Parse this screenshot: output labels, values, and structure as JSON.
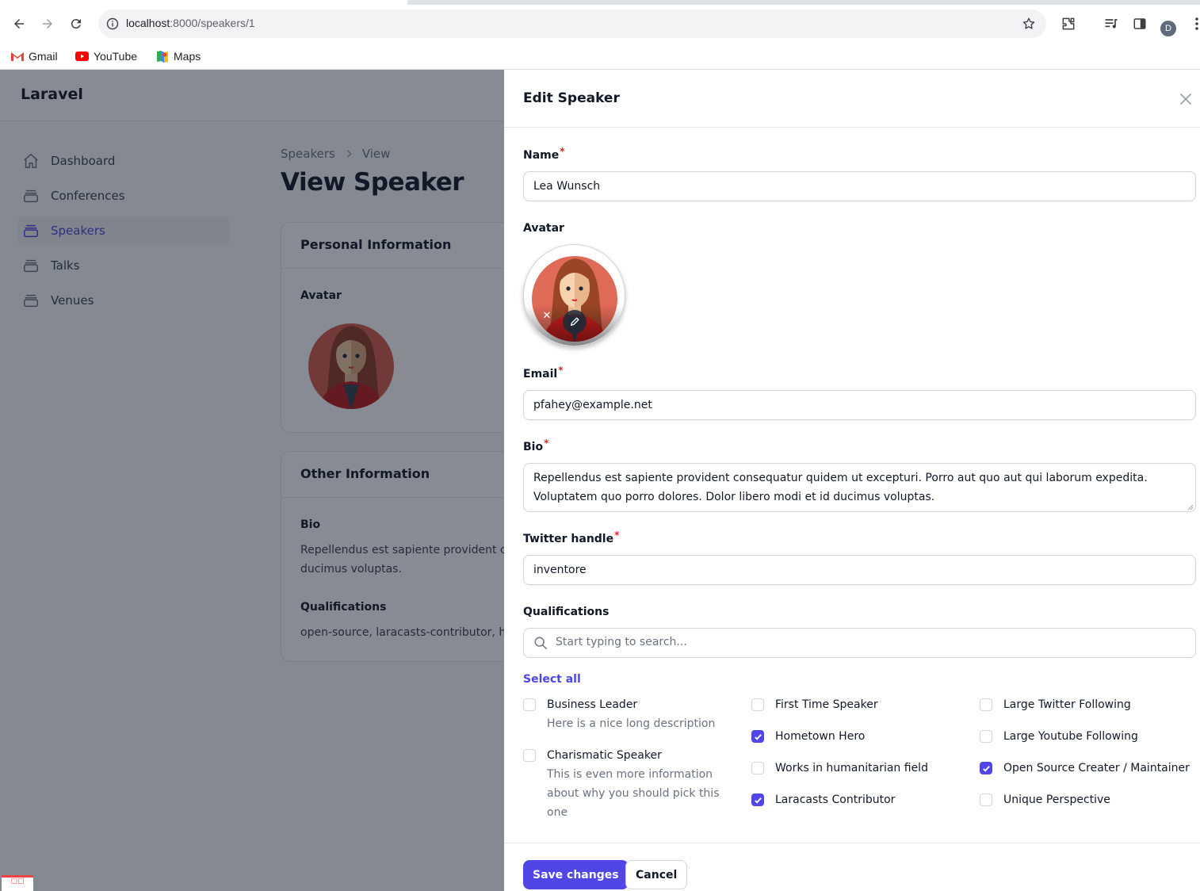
{
  "browser": {
    "url_host": "localhost",
    "url_path": ":8000/speakers/1",
    "profile_initial": "D",
    "bookmarks": [
      {
        "label": "Gmail",
        "icon": "gmail-icon"
      },
      {
        "label": "YouTube",
        "icon": "youtube-icon"
      },
      {
        "label": "Maps",
        "icon": "maps-icon"
      }
    ]
  },
  "app": {
    "brand": "Laravel",
    "nav": [
      {
        "label": "Dashboard",
        "icon": "home-icon",
        "active": false
      },
      {
        "label": "Conferences",
        "icon": "rectangle-stack-icon",
        "active": false
      },
      {
        "label": "Speakers",
        "icon": "rectangle-stack-icon",
        "active": true
      },
      {
        "label": "Talks",
        "icon": "rectangle-stack-icon",
        "active": false
      },
      {
        "label": "Venues",
        "icon": "rectangle-stack-icon",
        "active": false
      }
    ],
    "breadcrumbs": [
      "Speakers",
      "View"
    ],
    "page_title": "View Speaker",
    "personal_card": {
      "title": "Personal Information",
      "avatar_label": "Avatar"
    },
    "other_card": {
      "title": "Other Information",
      "bio_label": "Bio",
      "bio_line1": "Repellendus est sapiente provident cor",
      "bio_line2": "ducimus voluptas.",
      "qual_label": "Qualifications",
      "qual_value": "open-source, laracasts-contributor, hor"
    }
  },
  "modal": {
    "title": "Edit Speaker",
    "name": {
      "label": "Name",
      "value": "Lea Wunsch"
    },
    "avatar": {
      "label": "Avatar"
    },
    "email": {
      "label": "Email",
      "value": "pfahey@example.net"
    },
    "bio": {
      "label": "Bio",
      "value": "Repellendus est sapiente provident consequatur quidem ut excepturi. Porro aut quo aut qui laborum expedita. Voluptatem quo porro dolores. Dolor libero modi et id ducimus voluptas."
    },
    "twitter": {
      "label": "Twitter handle",
      "value": "inventore"
    },
    "qualifications": {
      "label": "Qualifications",
      "search_placeholder": "Start typing to search...",
      "select_all": "Select all",
      "options": [
        {
          "label": "Business Leader",
          "description": "Here is a nice long description",
          "checked": false
        },
        {
          "label": "Charismatic Speaker",
          "description": "This is even more information about why you should pick this one",
          "checked": false
        },
        {
          "label": "First Time Speaker",
          "checked": false
        },
        {
          "label": "Hometown Hero",
          "checked": true
        },
        {
          "label": "Works in humanitarian field",
          "checked": false
        },
        {
          "label": "Laracasts Contributor",
          "checked": true
        },
        {
          "label": "Large Twitter Following",
          "checked": false
        },
        {
          "label": "Large Youtube Following",
          "checked": false
        },
        {
          "label": "Open Source Creater / Maintainer",
          "checked": true
        },
        {
          "label": "Unique Perspective",
          "checked": false
        }
      ]
    },
    "save_label": "Save changes",
    "cancel_label": "Cancel"
  },
  "colors": {
    "accent": "#4f46e5",
    "required": "#dc2626"
  }
}
